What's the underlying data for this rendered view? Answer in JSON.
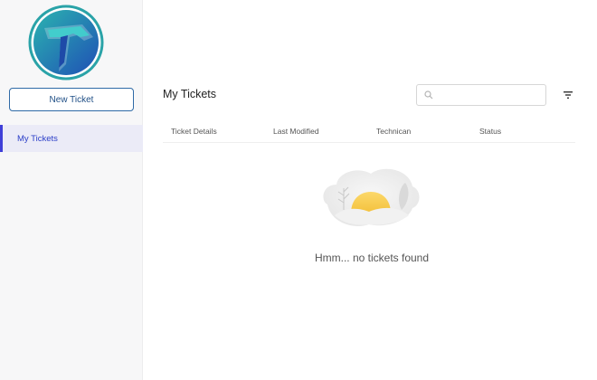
{
  "sidebar": {
    "new_ticket_label": "New Ticket",
    "items": [
      {
        "label": "My Tickets",
        "active": true
      }
    ]
  },
  "main": {
    "title": "My Tickets",
    "search": {
      "placeholder": "",
      "value": ""
    },
    "table": {
      "columns": [
        "Ticket Details",
        "Last Modified",
        "Technican",
        "Status"
      ],
      "rows": []
    },
    "empty_message": "Hmm... no tickets found"
  },
  "icons": {
    "logo": "brand-logo-icon",
    "search": "search-icon",
    "filter": "filter-icon",
    "empty": "empty-state-illustration"
  },
  "colors": {
    "accent": "#3f3fd8",
    "button_border": "#2f6aa6",
    "logo_ring": "#2aa3a8",
    "logo_blue": "#1f5fb3"
  }
}
